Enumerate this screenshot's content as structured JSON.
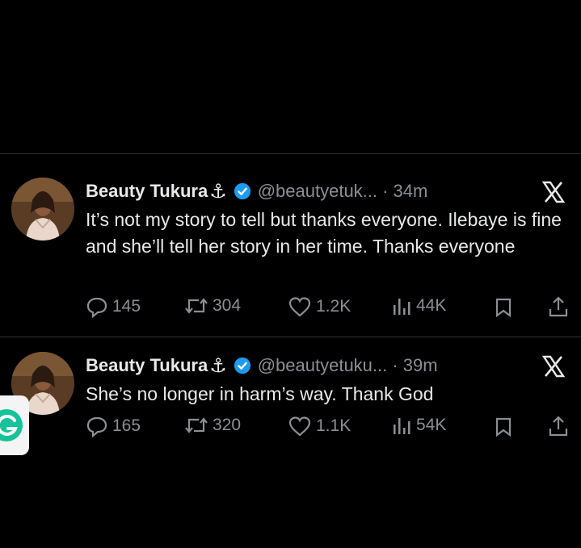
{
  "tweets": [
    {
      "author_name": "Beauty Tukura",
      "author_emoji": "⚓",
      "handle_time": "@beautyetuk... · 34m",
      "text": "It’s not my story to tell but thanks everyone. Ilebaye is fine and she’ll tell her story in her time. Thanks everyone",
      "replies": "145",
      "reposts": "304",
      "likes": "1.2K",
      "views": "44K"
    },
    {
      "author_name": "Beauty Tukura",
      "author_emoji": "⚓",
      "handle_time": "@beautyetuku... · 39m",
      "text": "She’s no longer in harm’s way. Thank God",
      "replies": "165",
      "reposts": "320",
      "likes": "1.1K",
      "views": "54K"
    }
  ],
  "colors": {
    "background": "#000000",
    "text": "#e7e9ea",
    "muted": "#8b8f94",
    "verified": "#1d9bf0",
    "divider": "#2f3336"
  },
  "icons": [
    "verified-badge-icon",
    "x-logo-icon",
    "reply-icon",
    "repost-icon",
    "like-icon",
    "views-icon",
    "bookmark-icon",
    "share-icon",
    "grammarly-g-icon"
  ]
}
